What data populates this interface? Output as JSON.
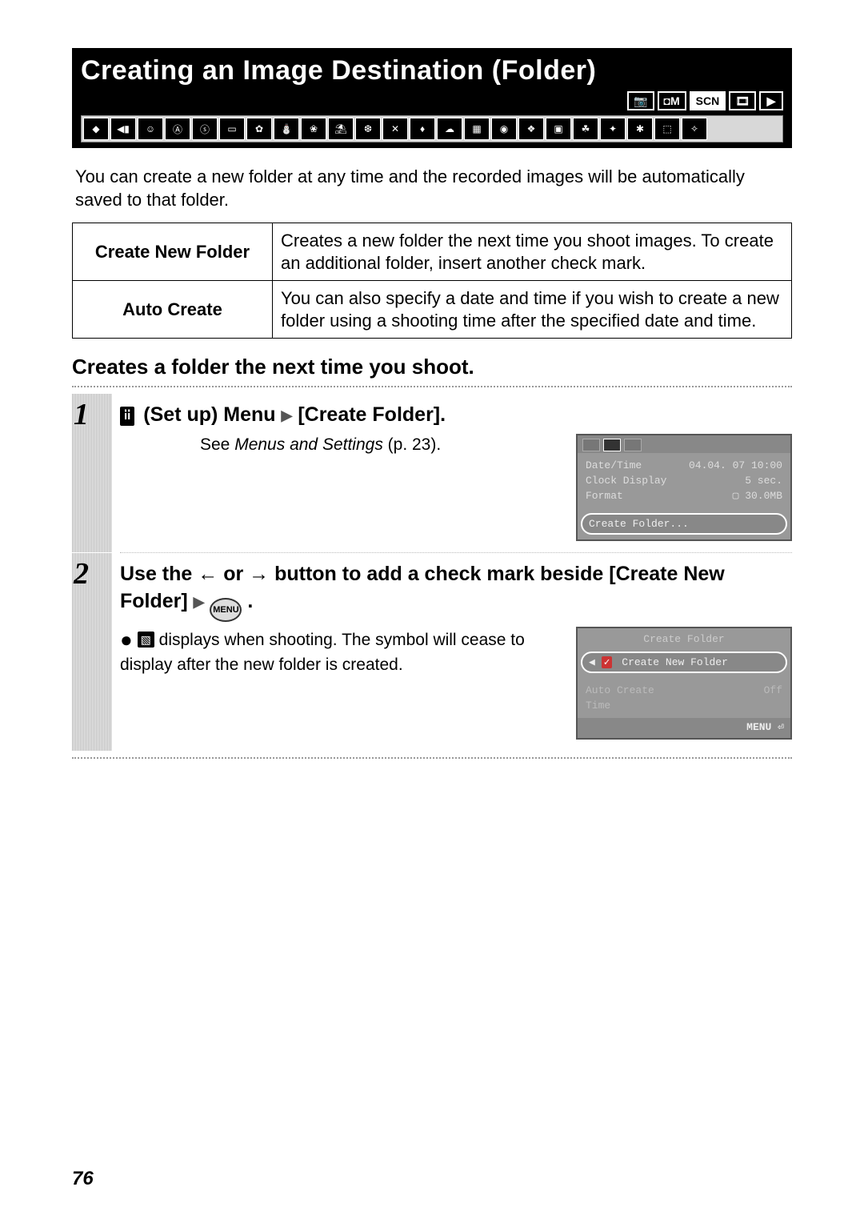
{
  "title": "Creating an Image Destination (Folder)",
  "mode_icons": [
    "📷",
    "◘M",
    "SCN",
    "🎞",
    "▶"
  ],
  "intro": "You can create a new folder at any time and the recorded images will be automatically saved to that folder.",
  "options": [
    {
      "label": "Create New Folder",
      "desc": "Creates a new folder the next time you shoot images. To create an additional folder, insert another check mark."
    },
    {
      "label": "Auto Create",
      "desc": "You can also specify a date and time if you wish to create a new folder using a shooting time after the specified date and time."
    }
  ],
  "subhead": "Creates a folder the next time you shoot.",
  "steps": {
    "s1": {
      "num": "1",
      "icon_label": "i̇i̇",
      "heading_a": "(Set up) Menu",
      "heading_b": "[Create Folder].",
      "see_prefix": "See ",
      "see_italic": "Menus and Settings",
      "see_suffix": " (p. 23).",
      "screen": {
        "rows": [
          {
            "k": "Date/Time",
            "v": "04.04. 07 10:00"
          },
          {
            "k": "Clock Display",
            "v": "5 sec."
          },
          {
            "k": "Format",
            "v": "▢  30.0MB"
          }
        ],
        "highlight": "Create Folder..."
      }
    },
    "s2": {
      "num": "2",
      "heading": "Use the  ←  or  →  button to add a check mark beside [Create New Folder]",
      "menu_label": "MENU",
      "bullet_text": " displays when shooting. The symbol will cease to display after the new folder is created.",
      "screen": {
        "title": "Create Folder",
        "highlight": "Create New Folder",
        "row2": {
          "k": "Auto Create",
          "v": "Off"
        },
        "row3": {
          "k": "Time",
          "v": ""
        },
        "menu_hint": "MENU ⏎"
      }
    }
  },
  "page_number": "76"
}
